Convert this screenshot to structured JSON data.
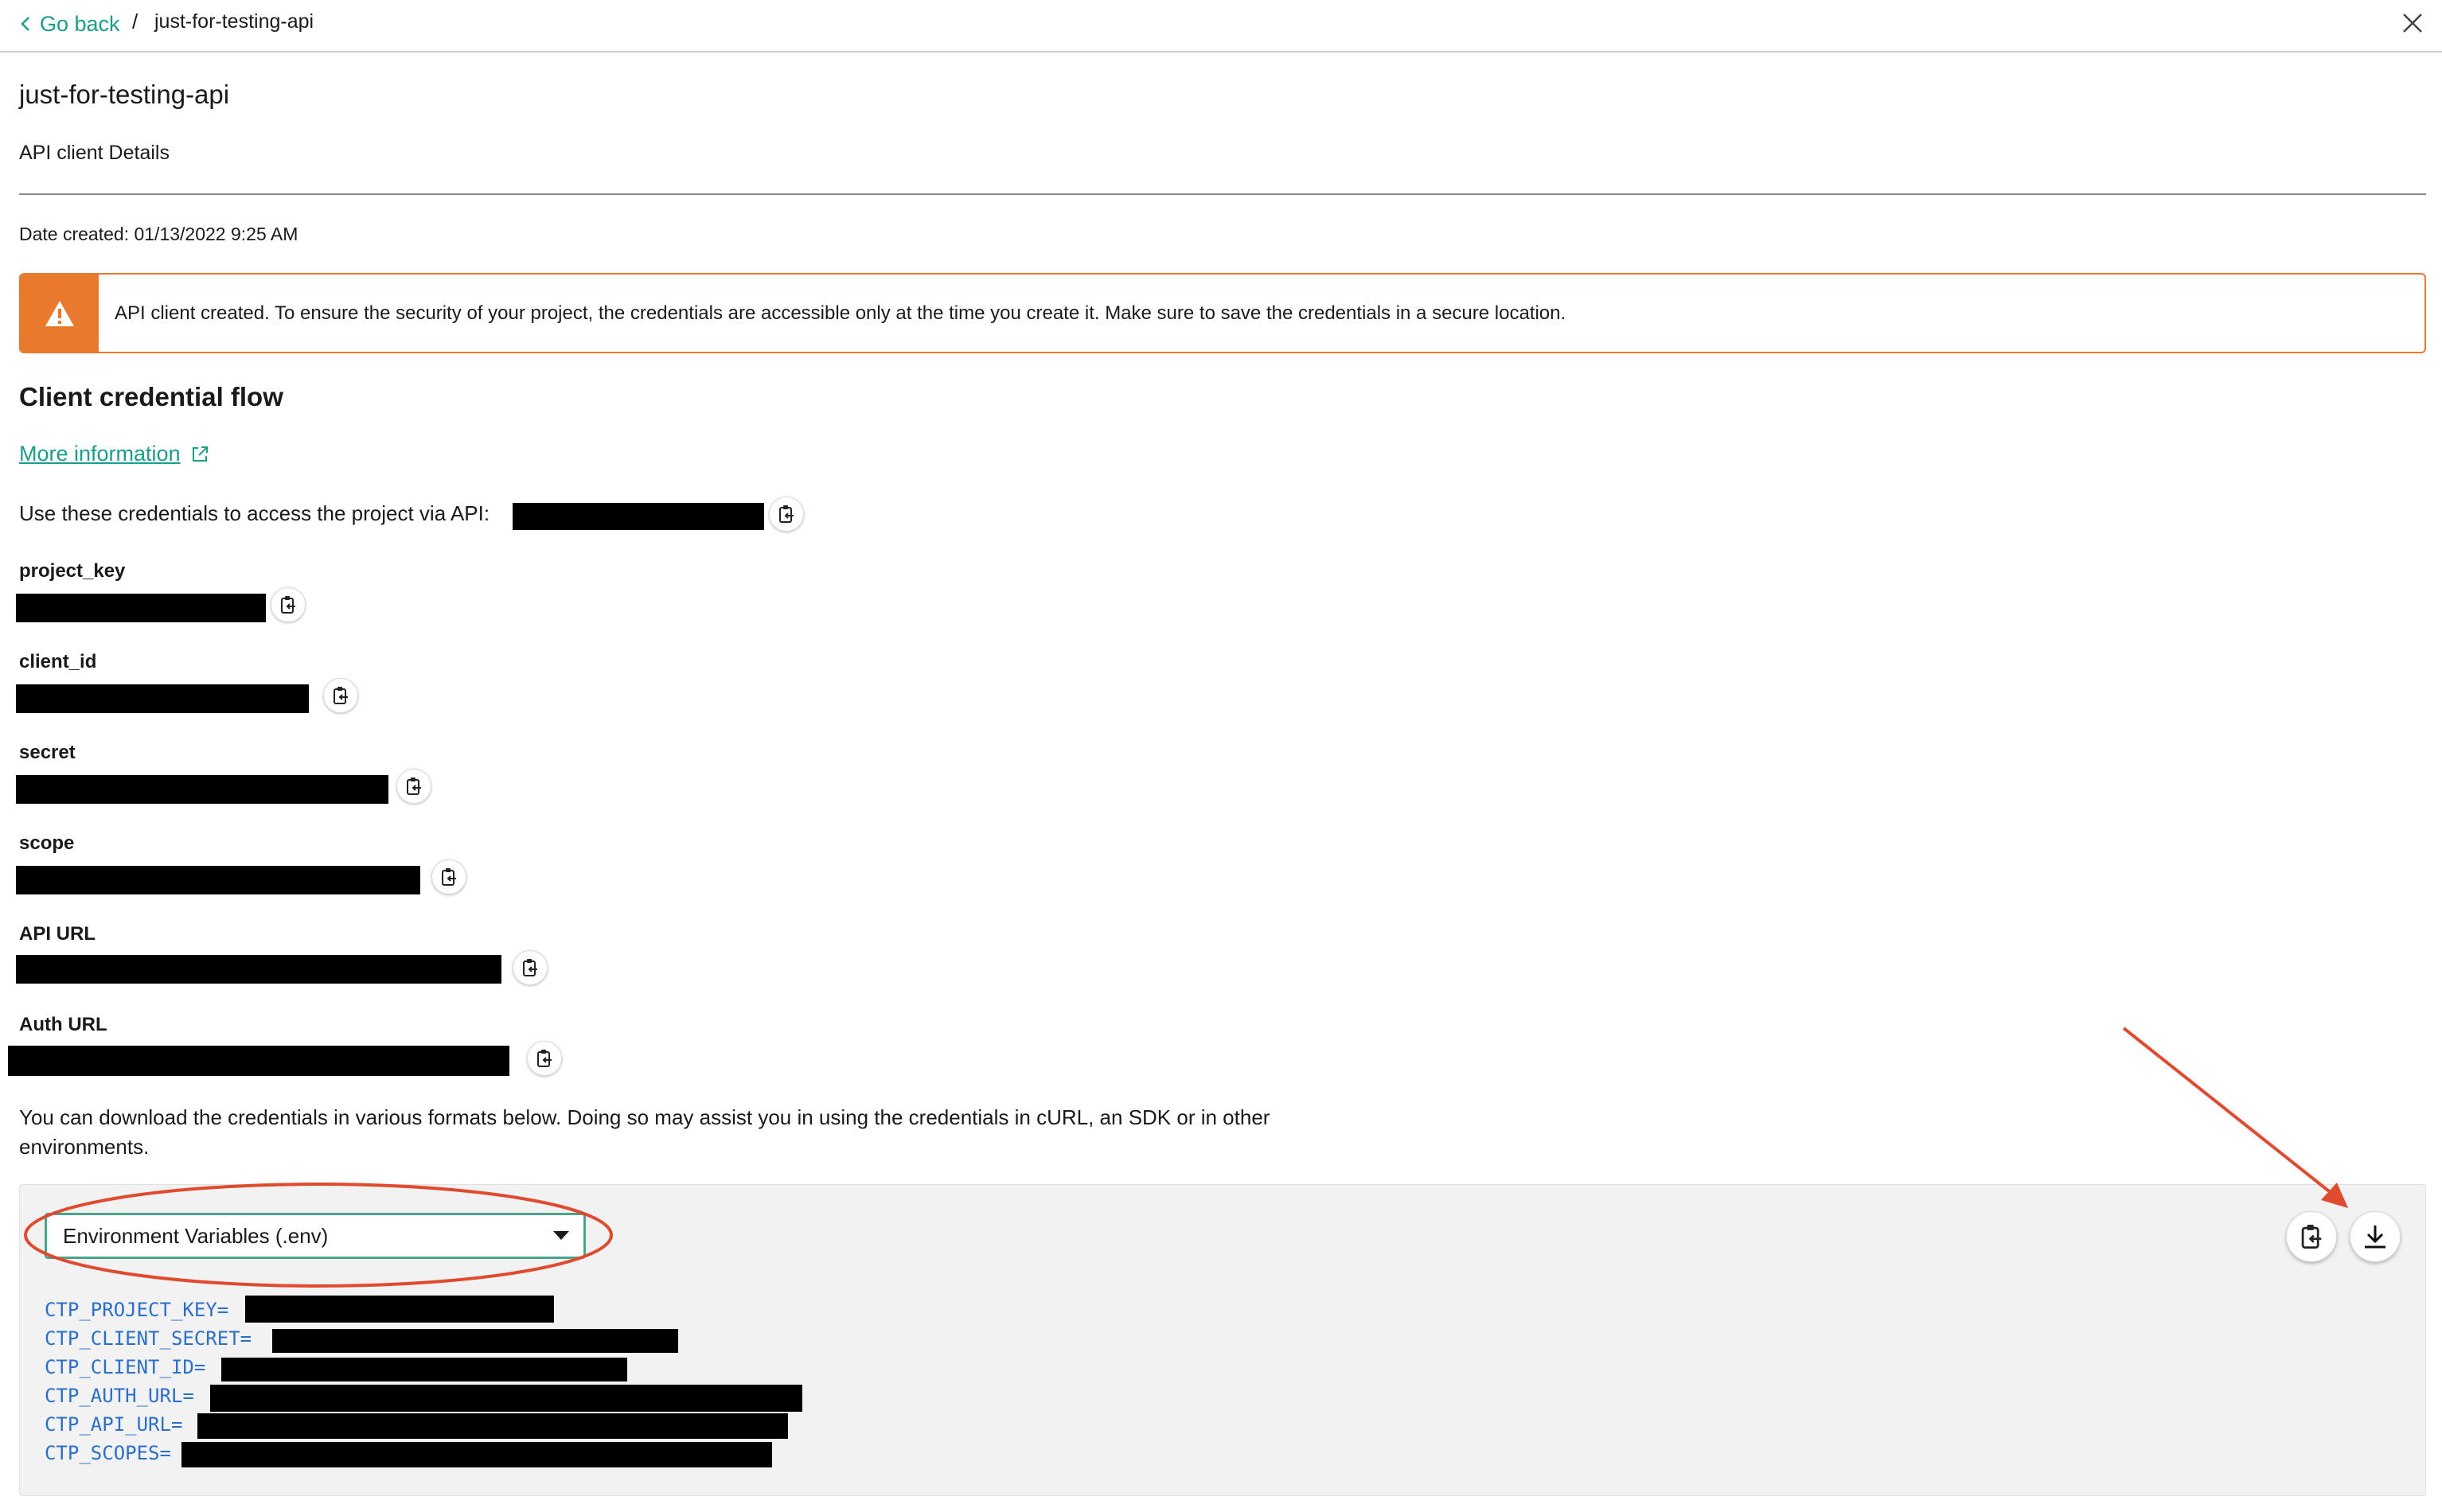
{
  "header": {
    "go_back": "Go back",
    "separator": "/",
    "current": "just-for-testing-api"
  },
  "page": {
    "title": "just-for-testing-api",
    "subtitle": "API client Details",
    "date_created": "Date created: 01/13/2022 9:25 AM"
  },
  "alert": {
    "text": "API client created. To ensure the security of your project, the credentials are accessible only at the time you create it. Make sure to save the credentials in a secure location."
  },
  "credentials": {
    "heading": "Client credential flow",
    "more_info": "More information",
    "use_text": "Use these credentials to access the project via API:",
    "fields": [
      {
        "label": "project_key"
      },
      {
        "label": "client_id"
      },
      {
        "label": "secret"
      },
      {
        "label": "scope"
      },
      {
        "label": "API URL"
      },
      {
        "label": "Auth URL"
      }
    ]
  },
  "download": {
    "text": "You can download the credentials in various formats below. Doing so may assist you in using the credentials in cURL, an SDK or in other environments.",
    "format_selected": "Environment Variables (.env)",
    "env_lines": [
      "CTP_PROJECT_KEY=",
      "CTP_CLIENT_SECRET=",
      "CTP_CLIENT_ID=",
      "CTP_AUTH_URL=",
      "CTP_API_URL=",
      "CTP_SCOPES="
    ]
  },
  "icons": {
    "copy": "clipboard-copy-icon",
    "download": "download-icon",
    "warning": "warning-icon",
    "external": "external-link-icon",
    "close": "close-icon",
    "back": "chevron-left-icon"
  },
  "colors": {
    "accent": "#1a9e8a",
    "warning": "#e8792d",
    "code": "#2a6fc9",
    "annotation": "#e04a2f"
  }
}
